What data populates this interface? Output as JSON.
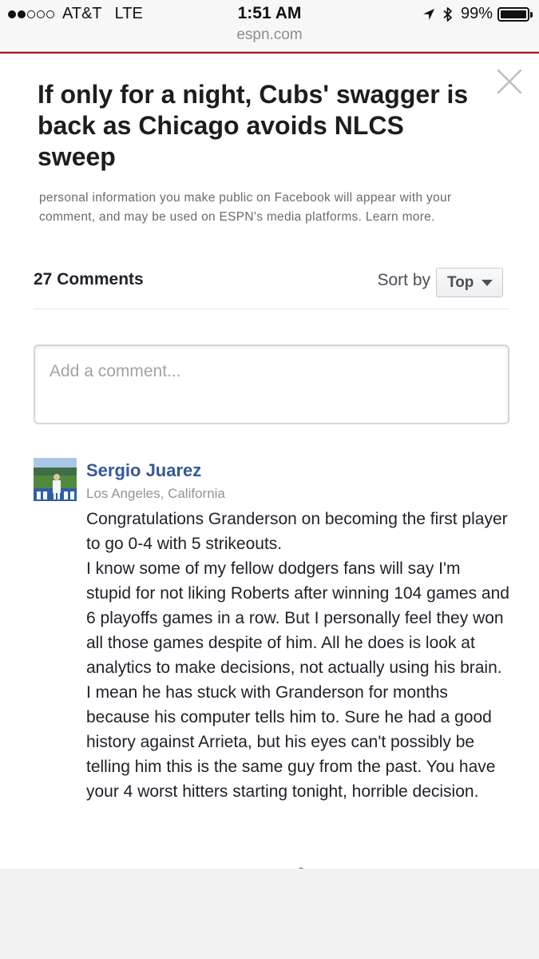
{
  "status_bar": {
    "carrier": "AT&T",
    "network": "LTE",
    "time": "1:51 AM",
    "battery": "99%",
    "battery_level": 0.99,
    "signal_bars": 2,
    "signal_total": 5,
    "url": "espn.com"
  },
  "article": {
    "title": "If only for a night, Cubs' swagger is back as Chicago avoids NLCS sweep"
  },
  "disclaimer": {
    "text": "personal information you make public on Facebook will appear with your comment, and may be used on ESPN's media platforms.",
    "learn_more": "Learn more."
  },
  "comments_header": {
    "count_label": "27 Comments",
    "sort_label": "Sort by",
    "sort_value": "Top"
  },
  "comment_input": {
    "placeholder": "Add a comment..."
  },
  "comment": {
    "author": "Sergio Juarez",
    "location": "Los Angeles, California",
    "paragraph_1": "Congratulations Granderson on becoming the first player to go 0-4 with 5 strikeouts.",
    "paragraph_2": "I know some of my fellow dodgers fans will say I'm stupid for not liking Roberts after winning 104 games and 6 playoffs games in a row. But I personally feel they won all those games despite of him. All he does is look at analytics to make decisions, not actually using his brain. I mean he has stuck with Granderson for months because his computer tells him to. Sure he had a good history against Arrieta, but his eyes can't possibly be telling him this is the same guy from the past. You have your 4 worst hitters starting tonight, horrible decision."
  },
  "colors": {
    "link_blue": "#365899",
    "espn_red": "#b01020",
    "text_dark": "#1d2129",
    "text_muted": "#90949c"
  },
  "icons": {
    "close": "close-icon",
    "location_arrow": "location-arrow-icon",
    "bluetooth": "bluetooth-icon",
    "battery": "battery-icon",
    "sort_caret": "chevron-down-icon",
    "avatar": "avatar-image"
  }
}
